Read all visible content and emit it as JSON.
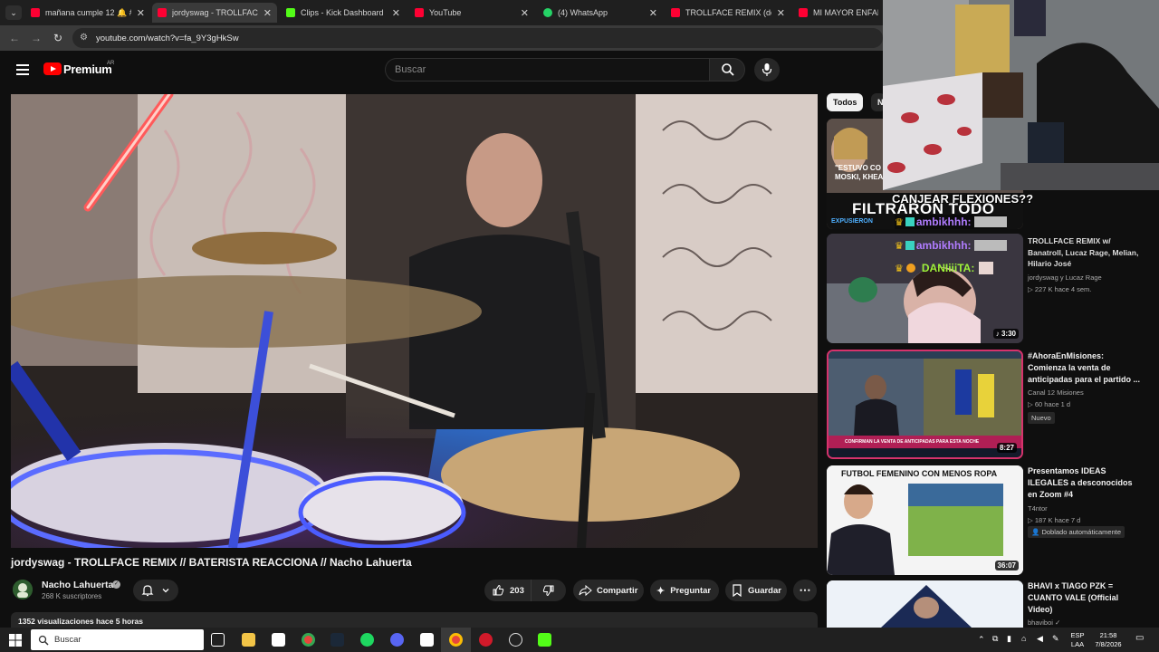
{
  "browser": {
    "tabs": [
      {
        "title": "mañana cumple 12 🔔 #1...",
        "favicon_color": "#ff0033",
        "active": false
      },
      {
        "title": "jordyswag - TROLLFACE RE",
        "favicon_color": "#ff0033",
        "active": true
      },
      {
        "title": "Clips - Kick Dashboard",
        "favicon_color": "#53fc18",
        "active": false
      },
      {
        "title": "YouTube",
        "favicon_color": "#ff0033",
        "active": false
      },
      {
        "title": "(4) WhatsApp",
        "favicon_color": "#25d366",
        "active": false
      },
      {
        "title": "TROLLFACE REMIX (docum",
        "favicon_color": "#ff0033",
        "active": false
      },
      {
        "title": "MI MAYOR ENFADO E",
        "favicon_color": "#ff0033",
        "active": false
      }
    ],
    "url": "youtube.com/watch?v=fa_9Y3gHkSw"
  },
  "youtube": {
    "logo_text": "Premium",
    "region": "AR",
    "search_placeholder": "Buscar"
  },
  "video": {
    "title": "jordyswag - TROLLFACE REMIX // BATERISTA REACCIONA // Nacho Lahuerta",
    "channel": "Nacho Lahuerta",
    "subscribers": "268 K suscriptores",
    "likes": "203",
    "share_label": "Compartir",
    "ask_label": "Preguntar",
    "save_label": "Guardar",
    "views_line": "1352 visualizaciones  hace 5 horas"
  },
  "filters": {
    "all_label": "Todos",
    "next_label": "N"
  },
  "recommendations": [
    {
      "title": "TROLLFACE REMIX w/ Banatroll, Lucaz Rage, Melian, Hilario José",
      "channel": "jordyswag y Lucaz Rage",
      "stats": "▷ 227 K  hace 4 sem.",
      "duration": "3:30",
      "badge": ""
    },
    {
      "title": "#AhoraEnMisiones: Comienza la venta de anticipadas para el partido ...",
      "channel": "Canal 12 Misiones",
      "stats": "▷ 60  hace 1 d",
      "duration": "8:27",
      "badge": "Nuevo"
    },
    {
      "title": "Presentamos IDEAS ILEGALES a desconocidos en Zoom #4",
      "channel": "T4ntor",
      "stats": "▷ 187 K  hace 7 d",
      "duration": "36:07",
      "badge": "Doblado automáticamente"
    },
    {
      "title": "BHAVI x TIAGO PZK = CUANTO VALE (Official Video)",
      "channel": "bhaviboi",
      "stats": "",
      "duration": "",
      "badge": ""
    }
  ],
  "thumb_texts": {
    "first_caption": "\"ESTUVO CO MOSKI, KHEA",
    "first_banner": "FILTRARON TODO",
    "first_sub": "EXPUSIERON",
    "news_banner": "CONFIRMAN LA VENTA DE ANTICIPADAS PARA ESTA NOCHE",
    "futbol_caption": "FUTBOL FEMENINO CON MENOS ROPA"
  },
  "stream_overlay": {
    "question": "CANJEAR FLEXIONES??",
    "chat": [
      {
        "user": "ambikhhh:"
      },
      {
        "user": "ambikhhh:"
      },
      {
        "user": "DANIiiiTA:"
      }
    ]
  },
  "taskbar": {
    "search_label": "Buscar",
    "lang_top": "ESP",
    "lang_bottom": "LAA",
    "time": "21:58",
    "date": "7/8/2026"
  }
}
